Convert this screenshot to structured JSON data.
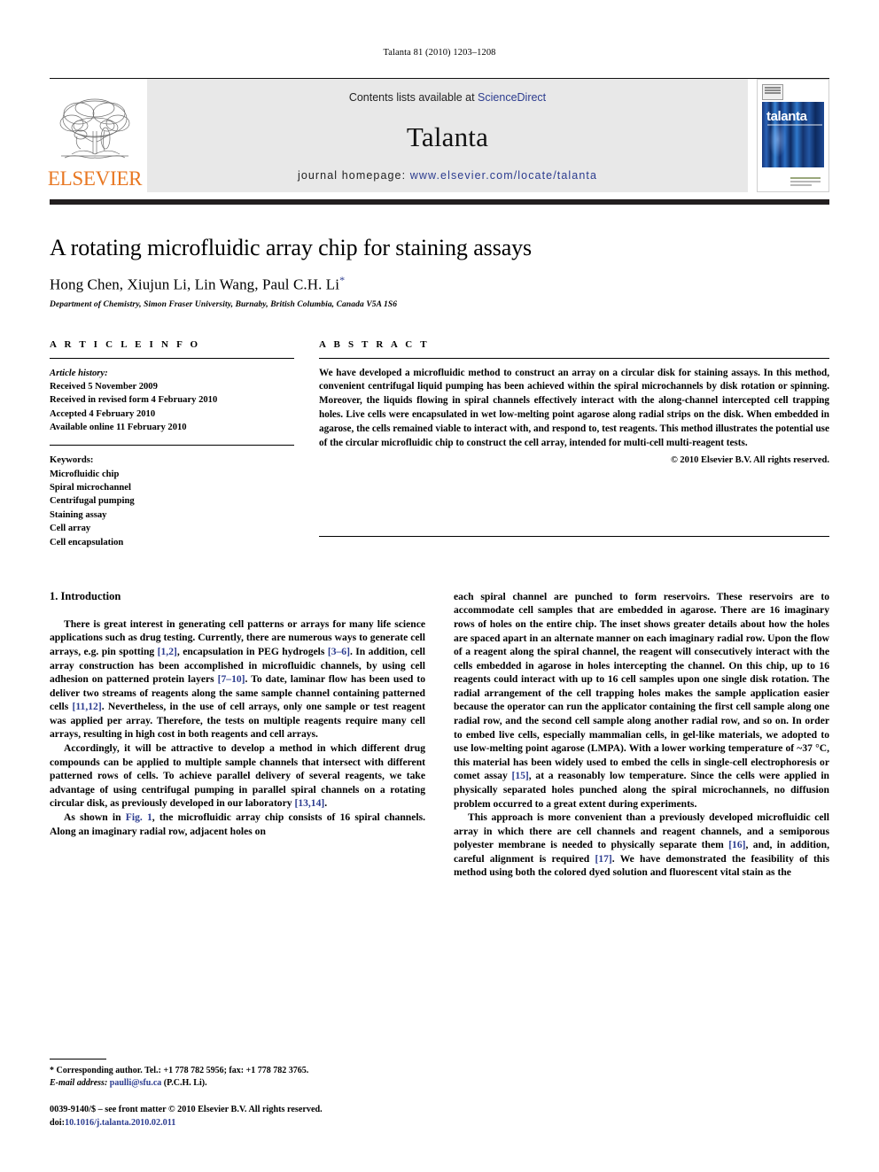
{
  "running_head": "Talanta 81 (2010) 1203–1208",
  "masthead": {
    "publisher_name": "ELSEVIER",
    "contents_prefix": "Contents lists available at ",
    "contents_link": "ScienceDirect",
    "journal_title": "Talanta",
    "homepage_prefix": "journal homepage: ",
    "homepage_url": "www.elsevier.com/locate/talanta",
    "cover_title": "talanta",
    "accent_orange": "#e87722",
    "link_blue": "#2c3c8f"
  },
  "title_block": {
    "title": "A rotating microfluidic array chip for staining assays",
    "authors": "Hong Chen, Xiujun Li, Lin Wang, Paul C.H. Li",
    "corresponding_marker": "*",
    "affiliation": "Department of Chemistry, Simon Fraser University, Burnaby, British Columbia, Canada V5A 1S6"
  },
  "article_info": {
    "heading": "A R T I C L E   I N F O",
    "history_label": "Article history:",
    "history": [
      "Received 5 November 2009",
      "Received in revised form 4 February 2010",
      "Accepted 4 February 2010",
      "Available online 11 February 2010"
    ],
    "keywords_label": "Keywords:",
    "keywords": [
      "Microfluidic chip",
      "Spiral microchannel",
      "Centrifugal pumping",
      "Staining assay",
      "Cell array",
      "Cell encapsulation"
    ]
  },
  "abstract": {
    "heading": "A B S T R A C T",
    "text": "We have developed a microfluidic method to construct an array on a circular disk for staining assays. In this method, convenient centrifugal liquid pumping has been achieved within the spiral microchannels by disk rotation or spinning. Moreover, the liquids flowing in spiral channels effectively interact with the along-channel intercepted cell trapping holes. Live cells were encapsulated in wet low-melting point agarose along radial strips on the disk. When embedded in agarose, the cells remained viable to interact with, and respond to, test reagents. This method illustrates the potential use of the circular microfluidic chip to construct the cell array, intended for multi-cell multi-reagent tests.",
    "copyright": "© 2010 Elsevier B.V. All rights reserved."
  },
  "body": {
    "section_number_title": "1.  Introduction",
    "left_paragraphs": [
      "There is great interest in generating cell patterns or arrays for many life science applications such as drug testing. Currently, there are numerous ways to generate cell arrays, e.g. pin spotting [1,2], encapsulation in PEG hydrogels [3–6]. In addition, cell array construction has been accomplished in microfluidic channels, by using cell adhesion on patterned protein layers [7–10]. To date, laminar flow has been used to deliver two streams of reagents along the same sample channel containing patterned cells [11,12]. Nevertheless, in the use of cell arrays, only one sample or test reagent was applied per array. Therefore, the tests on multiple reagents require many cell arrays, resulting in high cost in both reagents and cell arrays.",
      "Accordingly, it will be attractive to develop a method in which different drug compounds can be applied to multiple sample channels that intersect with different patterned rows of cells. To achieve parallel delivery of several reagents, we take advantage of using centrifugal pumping in parallel spiral channels on a rotating circular disk, as previously developed in our laboratory [13,14].",
      "As shown in Fig. 1, the microfluidic array chip consists of 16 spiral channels. Along an imaginary radial row, adjacent holes on"
    ],
    "right_paragraphs": [
      "each spiral channel are punched to form reservoirs. These reservoirs are to accommodate cell samples that are embedded in agarose. There are 16 imaginary rows of holes on the entire chip. The inset shows greater details about how the holes are spaced apart in an alternate manner on each imaginary radial row. Upon the flow of a reagent along the spiral channel, the reagent will consecutively interact with the cells embedded in agarose in holes intercepting the channel. On this chip, up to 16 reagents could interact with up to 16 cell samples upon one single disk rotation. The radial arrangement of the cell trapping holes makes the sample application easier because the operator can run the applicator containing the first cell sample along one radial row, and the second cell sample along another radial row, and so on. In order to embed live cells, especially mammalian cells, in gel-like materials, we adopted to use low-melting point agarose (LMPA). With a lower working temperature of ~37 °C, this material has been widely used to embed the cells in single-cell electrophoresis or comet assay [15], at a reasonably low temperature. Since the cells were applied in physically separated holes punched along the spiral microchannels, no diffusion problem occurred to a great extent during experiments.",
      "This approach is more convenient than a previously developed microfluidic cell array in which there are cell channels and reagent channels, and a semiporous polyester membrane is needed to physically separate them [16], and, in addition, careful alignment is required [17]. We have demonstrated the feasibility of this method using both the colored dyed solution and fluorescent vital stain as the"
    ]
  },
  "footnotes": {
    "corresponding": "* Corresponding author. Tel.: +1 778 782 5956; fax: +1 778 782 3765.",
    "email_label": "E-mail address:",
    "email": "paulli@sfu.ca",
    "email_suffix": "(P.C.H. Li).",
    "issn_line": "0039-9140/$ – see front matter © 2010 Elsevier B.V. All rights reserved.",
    "doi_label": "doi:",
    "doi_value": "10.1016/j.talanta.2010.02.011"
  }
}
